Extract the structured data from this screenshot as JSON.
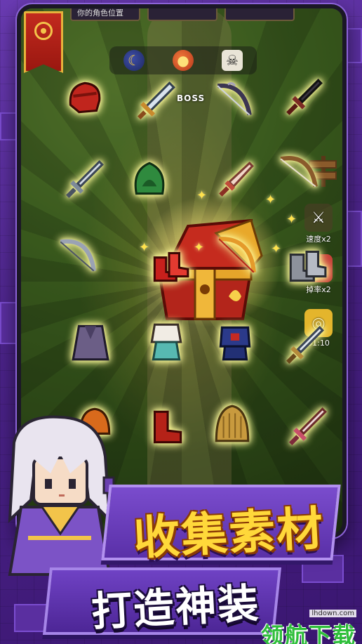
{
  "hud": {
    "top_pill_left": "你的角色位置",
    "boss_label": "BOSS"
  },
  "side": {
    "speed_label": "速度x2",
    "drop_label": "掉率x2",
    "drop_badge": "x2",
    "timer": "01:10"
  },
  "titles": {
    "line1": "收集素材",
    "line2": "打造神装"
  },
  "watermark": {
    "text": "领航下载",
    "url": "lhdown.com"
  },
  "colors": {
    "title_yellow": "#ffd83a",
    "panel_purple": "#6f42c4",
    "item_glow": "#f9f58a"
  },
  "items": [
    "red-helmet-icon",
    "short-sword-icon",
    "dark-bow-icon",
    "dark-dagger-icon",
    "steel-sword-icon",
    "green-hood-icon",
    "bone-dagger-icon",
    "wooden-bow-icon",
    "silver-bow-icon",
    "red-boots-icon",
    "golden-bow-icon",
    "iron-boots-icon",
    "purple-cloak-icon",
    "white-robe-icon",
    "blue-armor-icon",
    "silver-sword-icon",
    "orange-helm-icon",
    "red-boots-2-icon",
    "straw-cape-icon",
    "pink-sword-icon"
  ]
}
